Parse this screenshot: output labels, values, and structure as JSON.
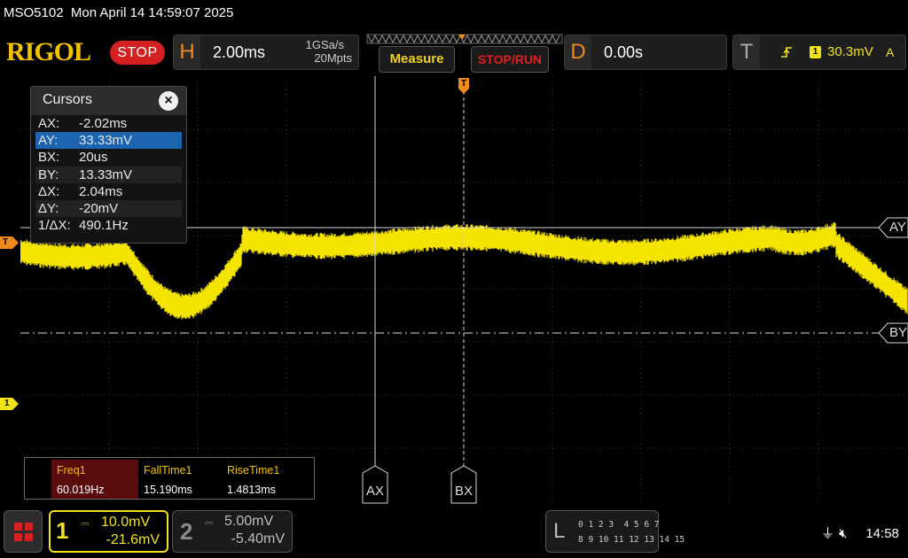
{
  "title_bar": {
    "model": "MSO5102",
    "datetime": "Mon April 14 14:59:07 2025"
  },
  "header": {
    "brand": "RIGOL",
    "run_state": "STOP",
    "horizontal": {
      "letter": "H",
      "timebase": "2.00ms",
      "sample_rate": "1GSa/s",
      "memory_depth": "20Mpts"
    },
    "measure_button": "Measure",
    "stop_run_button": "STOP/RUN",
    "delay": {
      "letter": "D",
      "value": "0.00s"
    },
    "trigger": {
      "letter": "T",
      "source": "1",
      "level": "30.3mV",
      "mode": "A"
    }
  },
  "cursors_panel": {
    "title": "Cursors",
    "close_symbol": "×",
    "rows": [
      {
        "key": "AX:",
        "value": "-2.02ms"
      },
      {
        "key": "AY:",
        "value": "33.33mV"
      },
      {
        "key": "BX:",
        "value": "20us"
      },
      {
        "key": "BY:",
        "value": "13.33mV"
      },
      {
        "key": "ΔX:",
        "value": "2.04ms"
      },
      {
        "key": "ΔY:",
        "value": "-20mV"
      },
      {
        "key": "1/ΔX:",
        "value": "490.1Hz"
      }
    ],
    "selected_row": 1
  },
  "markers": {
    "trigger_top": "T",
    "trigger_left": "T",
    "channel1_ground": "1",
    "cursor_ax": "AX",
    "cursor_bx": "BX",
    "cursor_ay": "AY",
    "cursor_by": "BY"
  },
  "measurements": [
    {
      "name": "Freq1",
      "value": "60.019Hz"
    },
    {
      "name": "FallTime1",
      "value": "15.190ms"
    },
    {
      "name": "RiseTime1",
      "value": "1.4813ms"
    }
  ],
  "channels": {
    "ch1": {
      "number": "1",
      "coupling_icon": "dc-coupling-icon",
      "scale": "10.0mV",
      "offset": "-21.6mV",
      "color": "#f2e21a"
    },
    "ch2": {
      "number": "2",
      "coupling_icon": "dc-coupling-icon",
      "scale": "5.00mV",
      "offset": "-5.40mV",
      "color": "#8a8a8a"
    }
  },
  "logic": {
    "letter": "L",
    "row1": "0 1 2 3  4 5 6 7",
    "row2": "8 9 10 11 12 13 14 15"
  },
  "status": {
    "usb_icon": "usb-icon",
    "sound_icon": "speaker-muted-icon",
    "clock": "14:58"
  },
  "colors": {
    "trace": "#f5e400",
    "brand": "#f2c200",
    "stop": "#d42020",
    "orange": "#f08a1c"
  }
}
